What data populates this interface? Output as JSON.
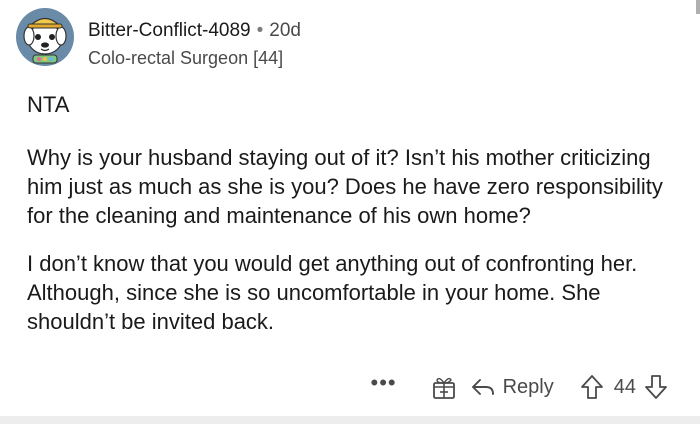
{
  "comment": {
    "author": "Bitter-Conflict-4089",
    "separator": "•",
    "age": "20d",
    "flair": "Colo-rectal Surgeon [44]",
    "paragraphs": [
      "NTA",
      "Why is your husband staying out of it? Isn’t his mother criticizing him just as much as she is you? Does he have zero responsibility for the cleaning and maintenance of his own home?",
      "I don’t know that you would get anything out of confronting her. Although, since she is so uncomfortable in your home. She shouldn’t be invited back."
    ]
  },
  "actions": {
    "more": "•••",
    "award_icon": "gift-box-icon",
    "reply_label": "Reply",
    "reply_icon": "reply-arrow-icon",
    "upvote_icon": "upvote-arrow-icon",
    "vote_count": "44",
    "downvote_icon": "downvote-arrow-icon"
  },
  "colors": {
    "text": "#1a1a1b",
    "muted": "#4a4a4a",
    "avatar_bg": "#6a8ba8",
    "avatar_face": "#ffffff",
    "hat": "#f2c94c"
  }
}
